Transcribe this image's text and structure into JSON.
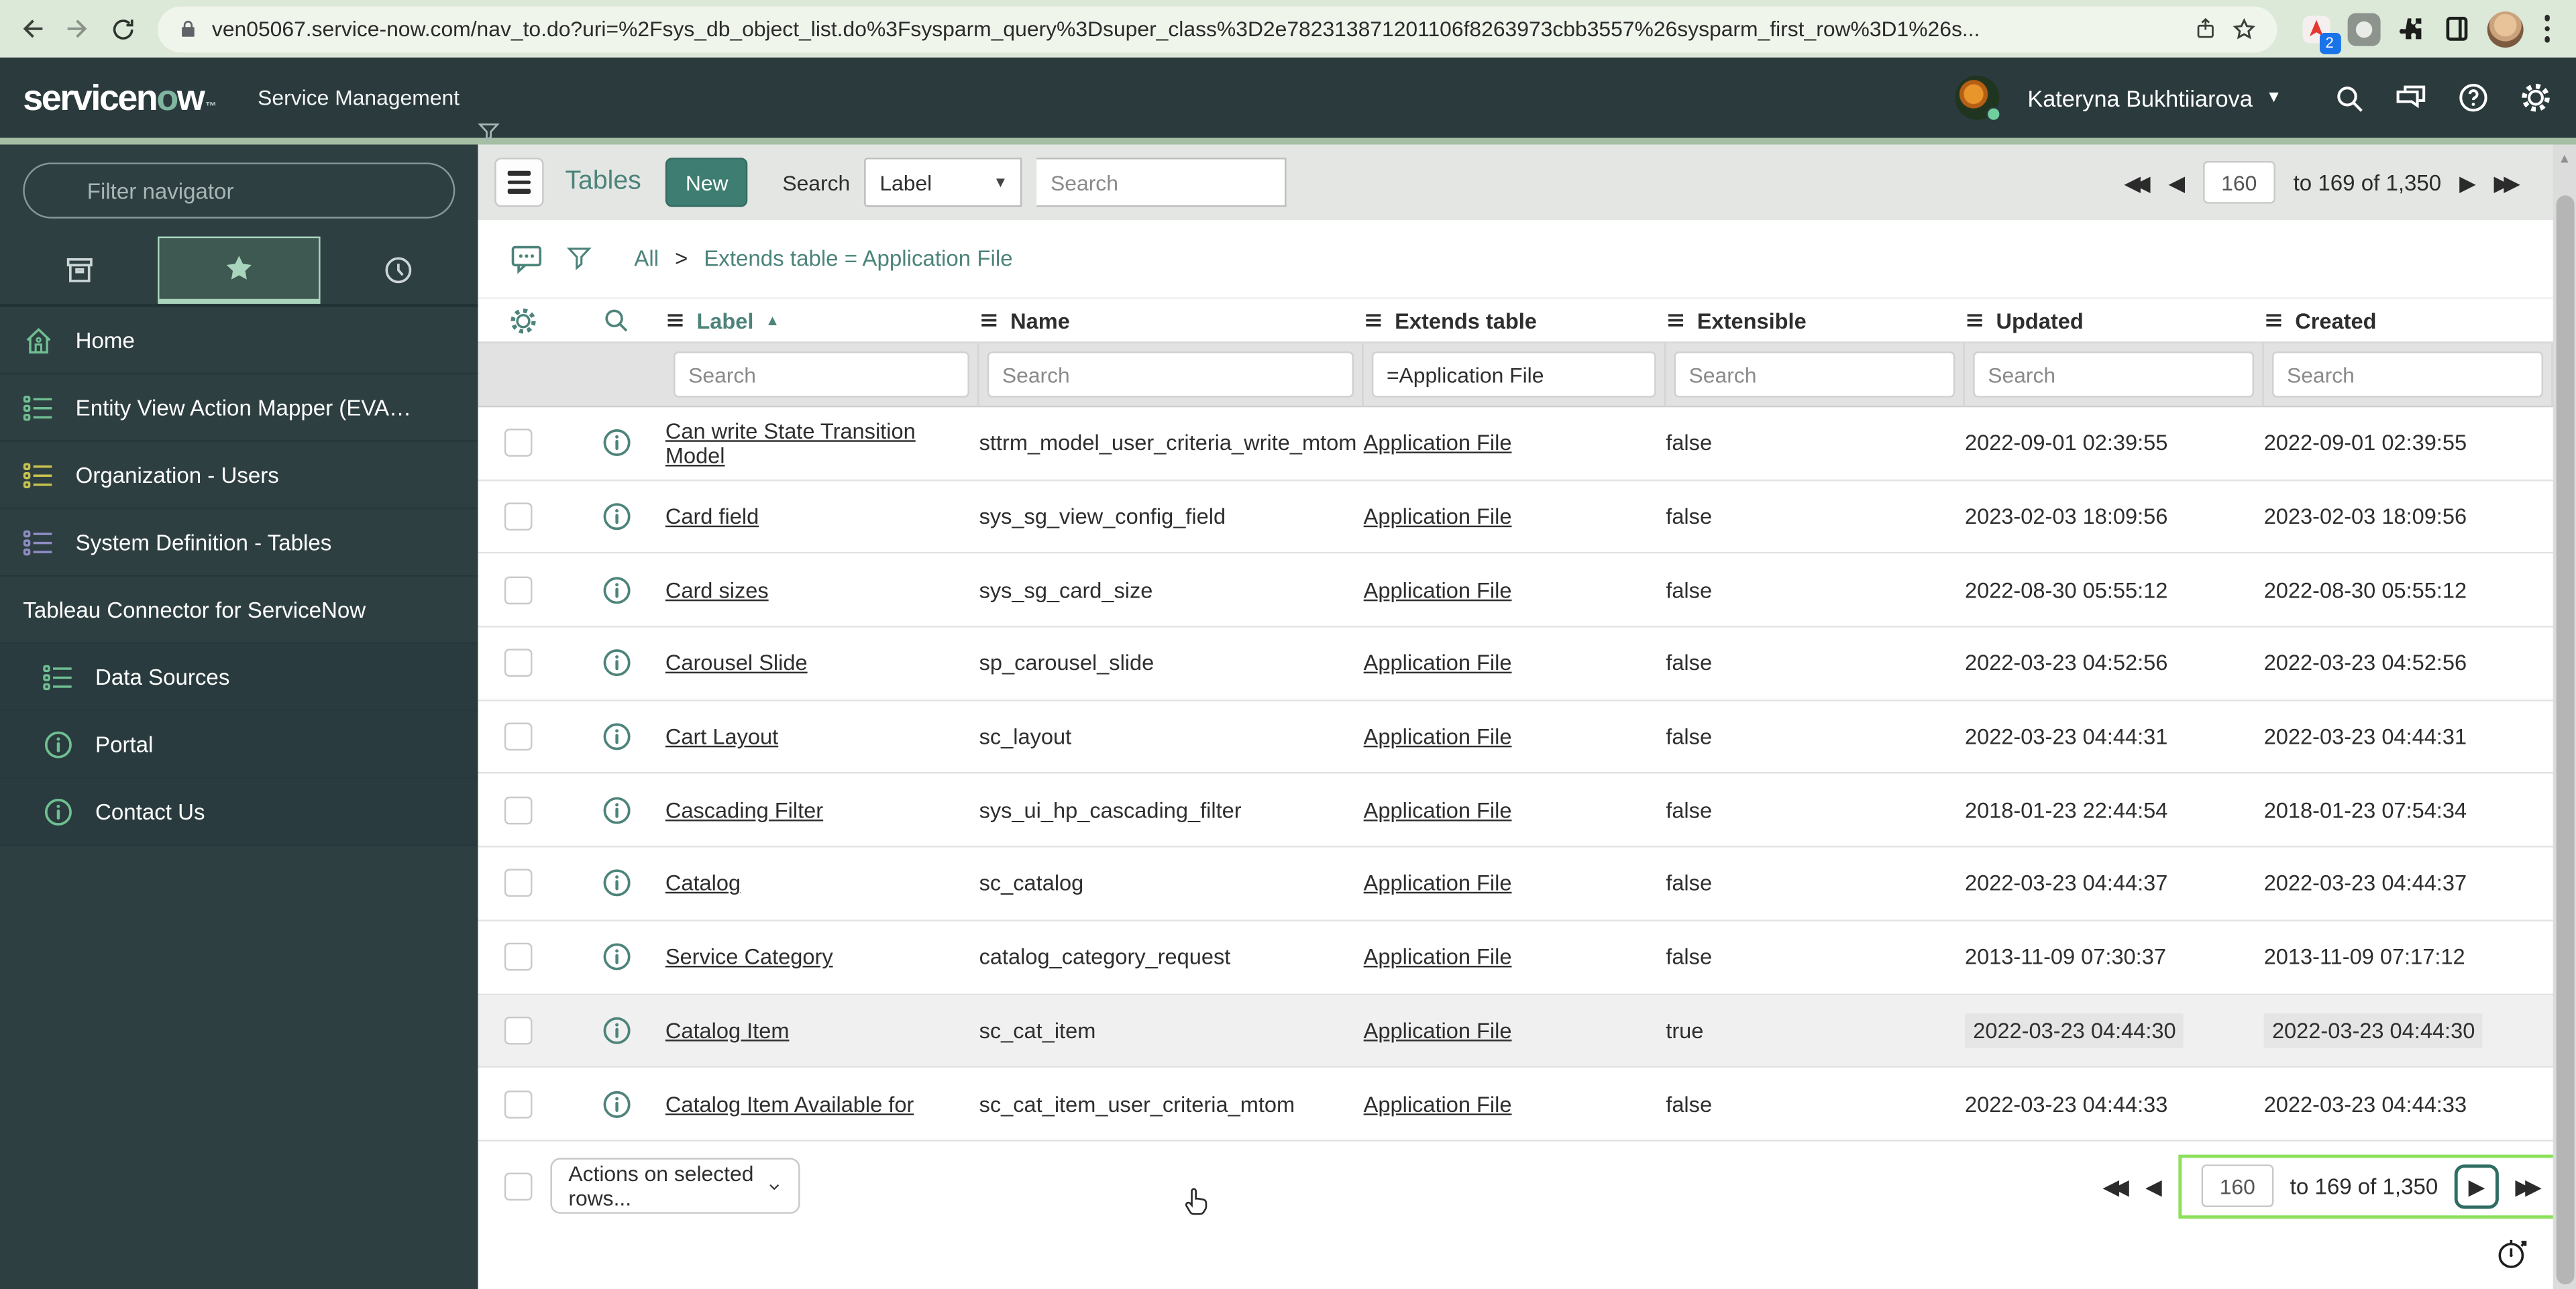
{
  "browser": {
    "url": "ven05067.service-now.com/nav_to.do?uri=%2Fsys_db_object_list.do%3Fsysparm_query%3Dsuper_class%3D2e782313871201106f8263973cbb3557%26sysparm_first_row%3D1%26s...",
    "extension_badge": "2"
  },
  "header": {
    "logo": {
      "pre": "servicen",
      "o": "o",
      "post": "w",
      "tm": "™"
    },
    "product": "Service Management",
    "user_name": "Kateryna Bukhtiiarova"
  },
  "sidebar": {
    "filter_placeholder": "Filter navigator",
    "items": [
      {
        "label": "Home",
        "icon": "home",
        "color": "#6fbf92"
      },
      {
        "label": "Entity View Action Mapper (EVA…",
        "icon": "list",
        "color": "#6fbf92"
      },
      {
        "label": "Organization - Users",
        "icon": "list",
        "color": "#c9c34e"
      },
      {
        "label": "System Definition - Tables",
        "icon": "list",
        "color": "#8f8cc4"
      },
      {
        "label": "Tableau Connector for ServiceNow",
        "icon": "none",
        "group": true
      },
      {
        "label": "Data Sources",
        "icon": "list",
        "color": "#6fbf92",
        "sub": true
      },
      {
        "label": "Portal",
        "icon": "info",
        "color": "#6fbf92",
        "sub": true
      },
      {
        "label": "Contact Us",
        "icon": "info",
        "color": "#6fbf92",
        "sub": true
      }
    ]
  },
  "toolbar": {
    "title": "Tables",
    "new_label": "New",
    "search_label": "Search",
    "field_selected": "Label",
    "search_placeholder": "Search"
  },
  "breadcrumb": {
    "root": "All",
    "separator": ">",
    "query": "Extends table = Application File"
  },
  "pagination": {
    "current": "160",
    "range_text": "to 169 of 1,350"
  },
  "list_actions": {
    "selected_rows_label": "Actions on selected rows..."
  },
  "table": {
    "columns": [
      "Label",
      "Name",
      "Extends table",
      "Extensible",
      "Updated",
      "Created"
    ],
    "filters": {
      "label_placeholder": "Search",
      "name_placeholder": "Search",
      "extends_value": "=Application File",
      "extensible_placeholder": "Search",
      "updated_placeholder": "Search",
      "created_placeholder": "Search"
    },
    "rows": [
      {
        "label": "Can write State Transition Model",
        "name": "sttrm_model_user_criteria_write_mtom",
        "extends": "Application File",
        "extensible": "false",
        "updated": "2022-09-01 02:39:55",
        "created": "2022-09-01 02:39:55"
      },
      {
        "label": "Card field",
        "name": "sys_sg_view_config_field",
        "extends": "Application File",
        "extensible": "false",
        "updated": "2023-02-03 18:09:56",
        "created": "2023-02-03 18:09:56"
      },
      {
        "label": "Card sizes",
        "name": "sys_sg_card_size",
        "extends": "Application File",
        "extensible": "false",
        "updated": "2022-08-30 05:55:12",
        "created": "2022-08-30 05:55:12"
      },
      {
        "label": "Carousel Slide",
        "name": "sp_carousel_slide",
        "extends": "Application File",
        "extensible": "false",
        "updated": "2022-03-23 04:52:56",
        "created": "2022-03-23 04:52:56"
      },
      {
        "label": "Cart Layout",
        "name": "sc_layout",
        "extends": "Application File",
        "extensible": "false",
        "updated": "2022-03-23 04:44:31",
        "created": "2022-03-23 04:44:31"
      },
      {
        "label": "Cascading Filter",
        "name": "sys_ui_hp_cascading_filter",
        "extends": "Application File",
        "extensible": "false",
        "updated": "2018-01-23 22:44:54",
        "created": "2018-01-23 07:54:34"
      },
      {
        "label": "Catalog",
        "name": "sc_catalog",
        "extends": "Application File",
        "extensible": "false",
        "updated": "2022-03-23 04:44:37",
        "created": "2022-03-23 04:44:37"
      },
      {
        "label": "Service Category",
        "name": "catalog_category_request",
        "extends": "Application File",
        "extensible": "false",
        "updated": "2013-11-09 07:30:37",
        "created": "2013-11-09 07:17:12"
      },
      {
        "label": "Catalog Item",
        "name": "sc_cat_item",
        "extends": "Application File",
        "extensible": "true",
        "updated": "2022-03-23 04:44:30",
        "created": "2022-03-23 04:44:30",
        "highlighted": true
      },
      {
        "label": "Catalog Item Available for",
        "name": "sc_cat_item_user_criteria_mtom",
        "extends": "Application File",
        "extensible": "false",
        "updated": "2022-03-23 04:44:33",
        "created": "2022-03-23 04:44:33"
      }
    ]
  }
}
